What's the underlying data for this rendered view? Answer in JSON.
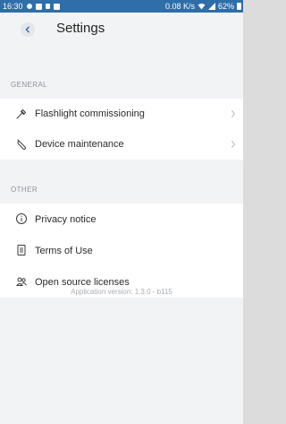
{
  "status_bar": {
    "time": "16:30",
    "speed": "0.08 K/s",
    "battery": "62%"
  },
  "header": {
    "title": "Settings",
    "back_icon": "chevron-left-icon"
  },
  "sections": {
    "general": {
      "label": "GENERAL",
      "items": [
        {
          "label": "Flashlight commissioning",
          "icon": "flashlight-icon",
          "has_chevron": true
        },
        {
          "label": "Device maintenance",
          "icon": "wrench-icon",
          "has_chevron": true
        }
      ]
    },
    "other": {
      "label": "OTHER",
      "items": [
        {
          "label": "Privacy notice",
          "icon": "info-icon"
        },
        {
          "label": "Terms of Use",
          "icon": "document-icon"
        },
        {
          "label": "Open source licenses",
          "icon": "people-icon"
        }
      ]
    }
  },
  "footer": {
    "version": "Application version: 1.3.0 - b115"
  },
  "colors": {
    "status_bar": "#2f6ea8",
    "background": "#f2f3f5",
    "row_background": "#ffffff",
    "text": "#2b2b2b",
    "muted": "#8d9399"
  }
}
